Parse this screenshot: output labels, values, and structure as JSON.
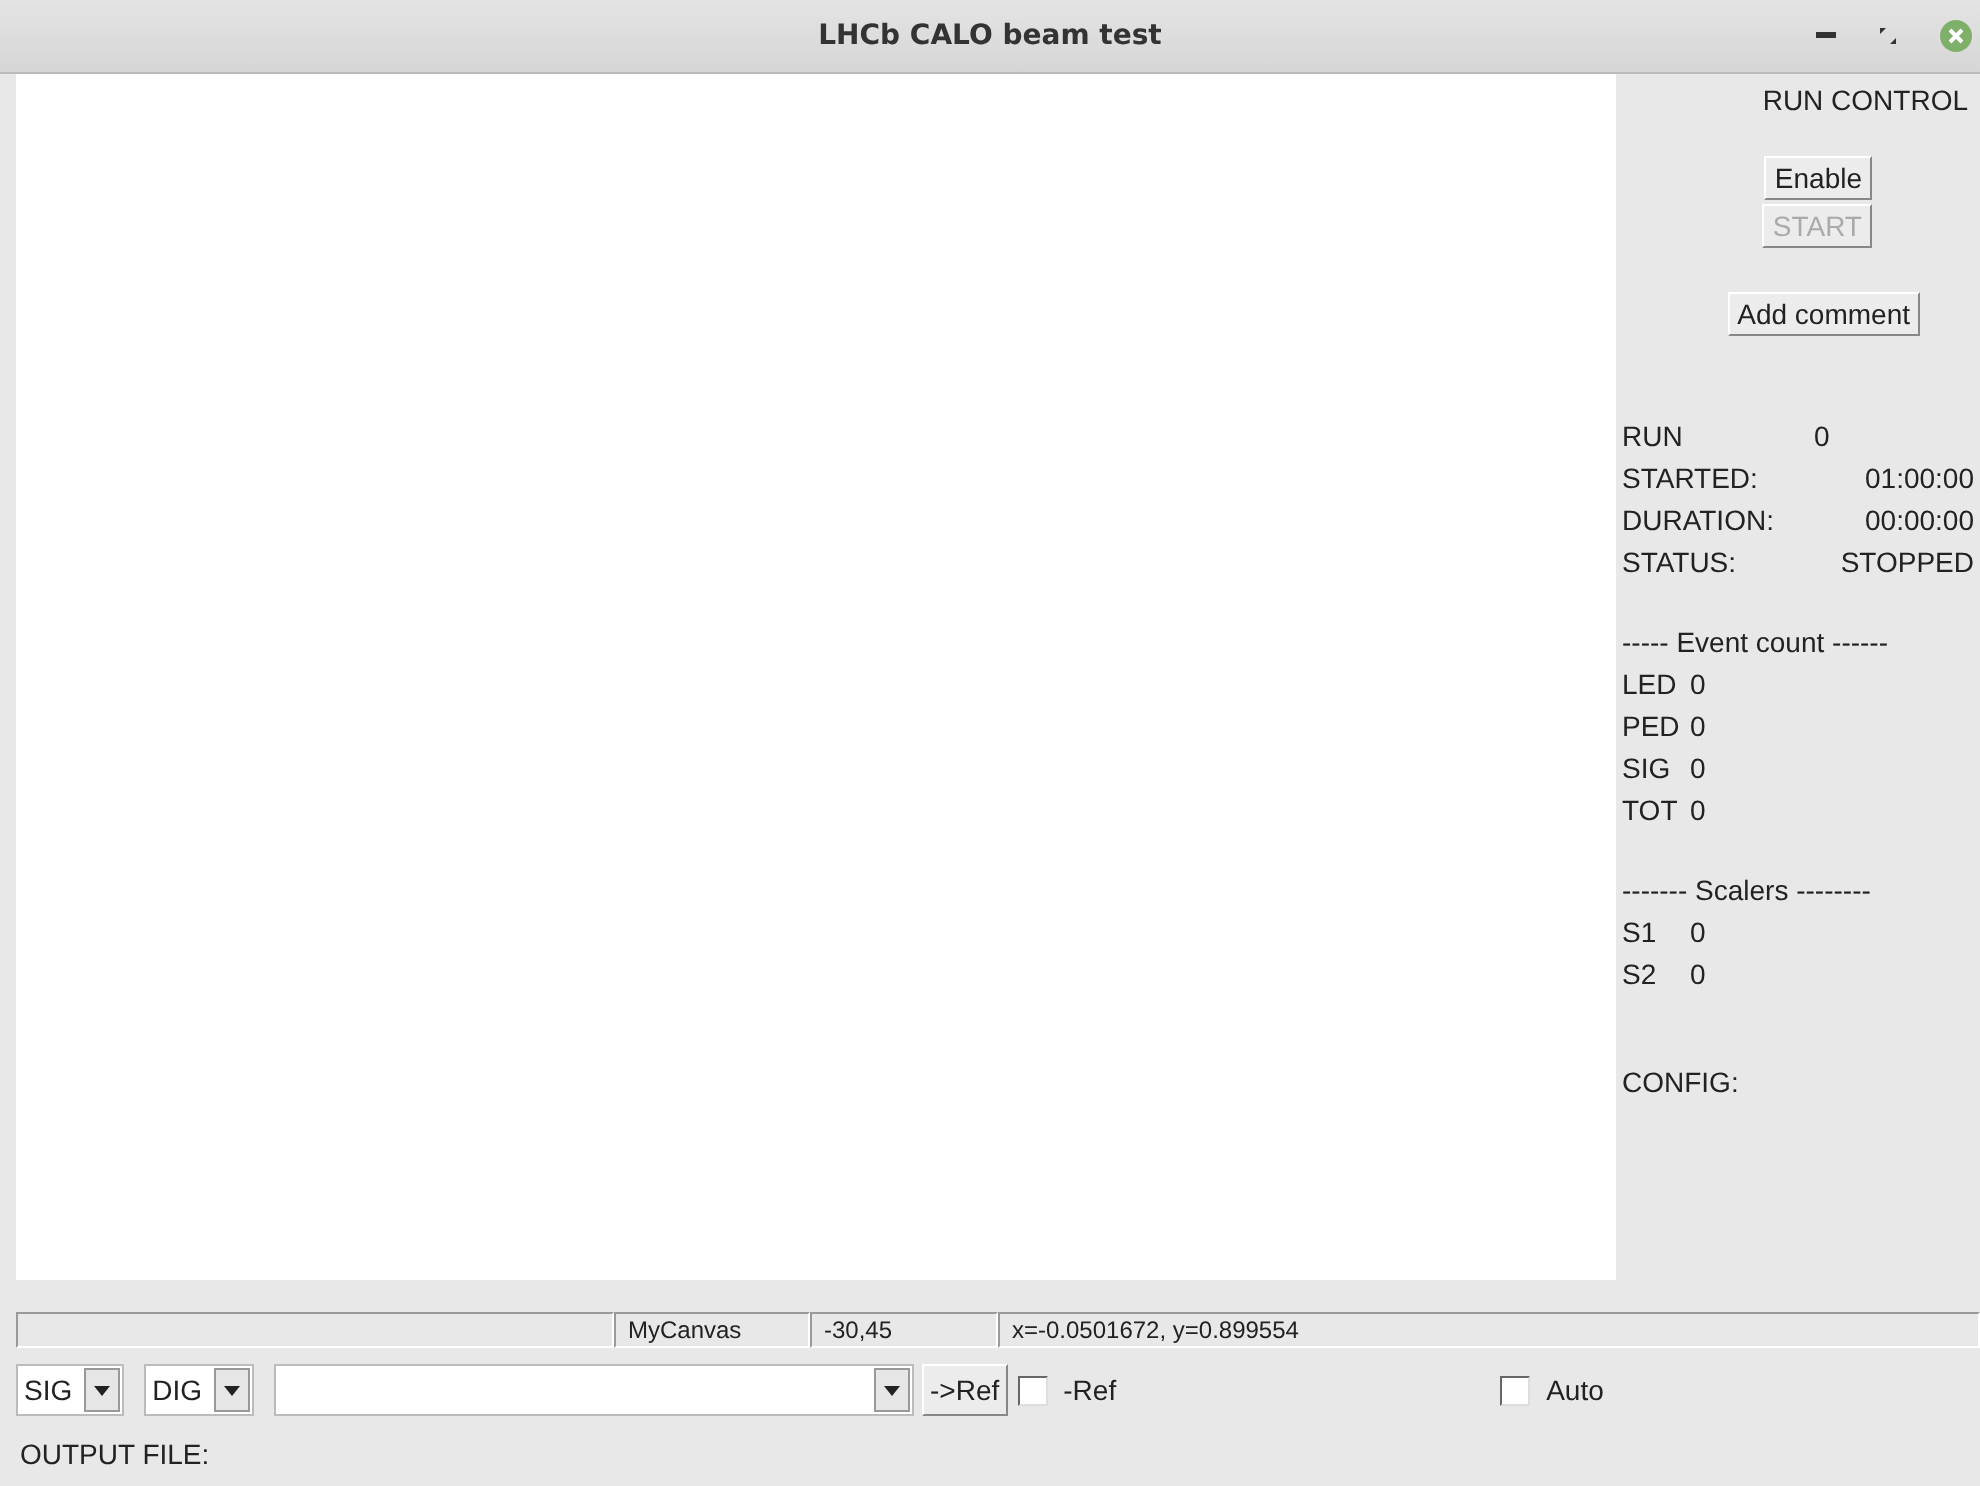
{
  "window": {
    "title": "LHCb CALO beam test"
  },
  "run_control": {
    "title": "RUN CONTROL",
    "buttons": [
      {
        "label": "Enable",
        "disabled": false,
        "kind": "small"
      },
      {
        "label": "START",
        "disabled": true,
        "kind": "small"
      },
      {
        "label": "Add comment",
        "disabled": false,
        "kind": "wide"
      }
    ],
    "info": [
      {
        "label": "RUN",
        "value": "0"
      },
      {
        "label": "STARTED:",
        "value": "01:00:00"
      },
      {
        "label": "DURATION:",
        "value": "00:00:00"
      },
      {
        "label": "STATUS:",
        "value": "STOPPED"
      }
    ],
    "event_count": {
      "heading": "----- Event count ------",
      "rows": [
        {
          "label": "LED",
          "value": "0"
        },
        {
          "label": "PED",
          "value": "0"
        },
        {
          "label": "SIG",
          "value": "0"
        },
        {
          "label": "TOT",
          "value": "0"
        }
      ]
    },
    "scalers": {
      "heading": "------- Scalers --------",
      "rows": [
        {
          "label": "S1",
          "value": "0"
        },
        {
          "label": "S2",
          "value": "0"
        }
      ]
    },
    "config_label": "CONFIG:"
  },
  "status_bar": [
    "MyCanvas",
    "-30,45",
    "x=-0.0501672, y=0.899554"
  ],
  "controls": {
    "selects": [
      "SIG",
      "DIG"
    ],
    "ref_button": "->Ref",
    "checkboxes": [
      {
        "label": "-Ref",
        "checked": false
      },
      {
        "label": "Auto",
        "checked": false
      }
    ]
  },
  "output_label": "OUTPUT FILE:"
}
